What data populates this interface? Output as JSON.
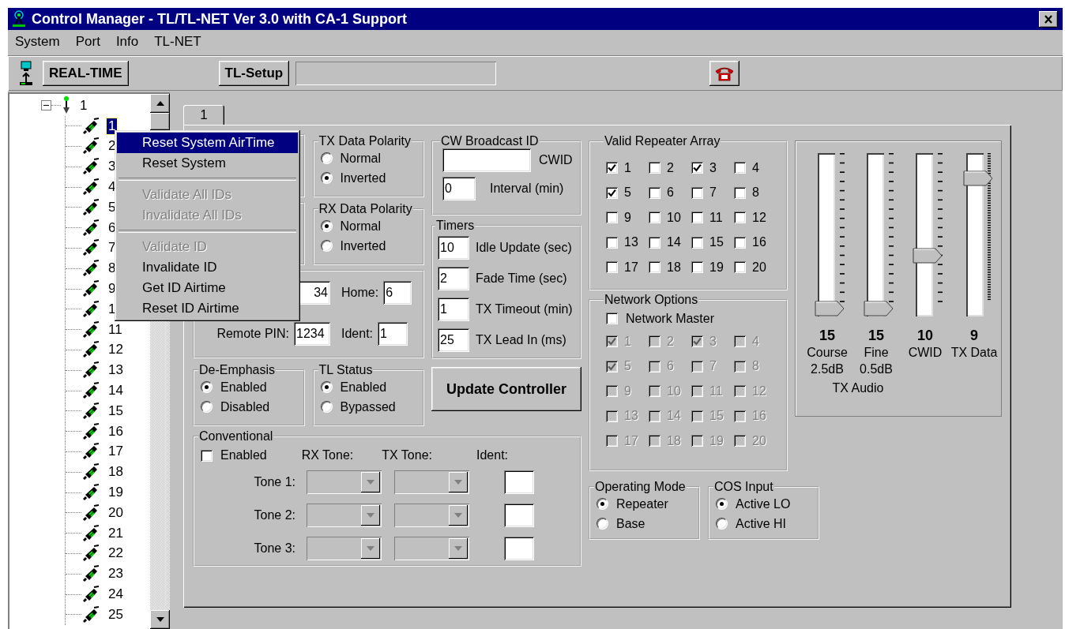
{
  "window": {
    "title": "Control Manager - TL/TL-NET Ver 3.0 with CA-1 Support"
  },
  "menu_bar": [
    {
      "label": "System"
    },
    {
      "label": "Port"
    },
    {
      "label": "Info"
    },
    {
      "label": "TL-NET"
    }
  ],
  "toolbar": {
    "realtime_button": "REAL-TIME",
    "setup_button": "TL-Setup"
  },
  "tree": {
    "label": "1",
    "expanded": true,
    "children": [
      {
        "label": "1",
        "selected": true
      },
      {
        "label": "2",
        "selected": false
      },
      {
        "label": "3",
        "selected": false
      },
      {
        "label": "4",
        "selected": false
      },
      {
        "label": "5",
        "selected": false
      },
      {
        "label": "6",
        "selected": false
      },
      {
        "label": "7",
        "selected": false
      },
      {
        "label": "8",
        "selected": false
      },
      {
        "label": "9",
        "selected": false
      },
      {
        "label": "1",
        "selected": false
      },
      {
        "label": "11",
        "selected": false
      },
      {
        "label": "12",
        "selected": false
      },
      {
        "label": "13",
        "selected": false
      },
      {
        "label": "14",
        "selected": false
      },
      {
        "label": "15",
        "selected": false
      },
      {
        "label": "16",
        "selected": false
      },
      {
        "label": "17",
        "selected": false
      },
      {
        "label": "18",
        "selected": false
      },
      {
        "label": "19",
        "selected": false
      },
      {
        "label": "20",
        "selected": false
      },
      {
        "label": "21",
        "selected": false
      },
      {
        "label": "22",
        "selected": false
      },
      {
        "label": "23",
        "selected": false
      },
      {
        "label": "24",
        "selected": false
      },
      {
        "label": "25",
        "selected": false
      }
    ]
  },
  "context_menu": [
    {
      "kind": "item",
      "label": "Reset System AirTime",
      "selected": true,
      "disabled": false
    },
    {
      "kind": "item",
      "label": "Reset System",
      "selected": false,
      "disabled": false
    },
    {
      "kind": "separator"
    },
    {
      "kind": "item",
      "label": "Validate All IDs",
      "selected": false,
      "disabled": true
    },
    {
      "kind": "item",
      "label": "Invalidate All IDs",
      "selected": false,
      "disabled": true
    },
    {
      "kind": "separator"
    },
    {
      "kind": "item",
      "label": "Validate ID",
      "selected": false,
      "disabled": true
    },
    {
      "kind": "item",
      "label": "Invalidate ID",
      "selected": false,
      "disabled": false
    },
    {
      "kind": "item",
      "label": "Get ID Airtime",
      "selected": false,
      "disabled": false
    },
    {
      "kind": "item",
      "label": "Reset ID Airtime",
      "selected": false,
      "disabled": false
    }
  ],
  "tabs": [
    {
      "label": "1",
      "selected": true
    }
  ],
  "tx_data_polarity": {
    "title": "TX Data Polarity",
    "options": [
      {
        "label": "Normal",
        "selected": false
      },
      {
        "label": "Inverted",
        "selected": true
      }
    ]
  },
  "rx_data_polarity": {
    "title": "RX Data Polarity",
    "options": [
      {
        "label": "Normal",
        "selected": true
      },
      {
        "label": "Inverted",
        "selected": false
      }
    ]
  },
  "id_fields": [
    {
      "value": "34"
    },
    {
      "label": "Home:",
      "value": "6"
    },
    {
      "label": "Remote PIN:",
      "value": "1234"
    },
    {
      "label": "Ident:",
      "value": "1"
    }
  ],
  "cw_broadcast_id": {
    "title": "CW Broadcast ID",
    "fields": [
      {
        "label": "CWID"
      },
      {
        "label": "Interval (min)",
        "value": "0"
      }
    ]
  },
  "timers": {
    "title": "Timers",
    "fields": [
      {
        "label": "Idle Update (sec)",
        "value": "10"
      },
      {
        "label": "Fade Time (sec)",
        "value": "2"
      },
      {
        "label": "TX Timeout (min)",
        "value": "1"
      },
      {
        "label": "TX Lead In (ms)",
        "value": "25"
      }
    ]
  },
  "update_button": "Update Controller",
  "de_emphasis": {
    "title": "De-Emphasis",
    "options": [
      {
        "label": "Enabled",
        "selected": true
      },
      {
        "label": "Disabled",
        "selected": false
      }
    ]
  },
  "tl_status": {
    "title": "TL Status",
    "options": [
      {
        "label": "Enabled",
        "selected": true
      },
      {
        "label": "Bypassed",
        "selected": false
      }
    ]
  },
  "conventional": {
    "title": "Conventional",
    "enabled": {
      "label": "Enabled",
      "checked": false
    },
    "headers": [
      "RX Tone:",
      "TX Tone:",
      "Ident:"
    ],
    "rows": [
      {
        "label": "Tone 1:",
        "disabled": true
      },
      {
        "label": "Tone 2:",
        "disabled": true
      },
      {
        "label": "Tone 3:",
        "disabled": true
      }
    ]
  },
  "valid_repeater_array": {
    "title": "Valid Repeater Array",
    "disabled": false,
    "items": [
      {
        "label": "1",
        "checked": true
      },
      {
        "label": "2",
        "checked": false
      },
      {
        "label": "3",
        "checked": true
      },
      {
        "label": "4",
        "checked": false
      },
      {
        "label": "5",
        "checked": true
      },
      {
        "label": "6",
        "checked": false
      },
      {
        "label": "7",
        "checked": false
      },
      {
        "label": "8",
        "checked": false
      },
      {
        "label": "9",
        "checked": false
      },
      {
        "label": "10",
        "checked": false
      },
      {
        "label": "11",
        "checked": false
      },
      {
        "label": "12",
        "checked": false
      },
      {
        "label": "13",
        "checked": false
      },
      {
        "label": "14",
        "checked": false
      },
      {
        "label": "15",
        "checked": false
      },
      {
        "label": "16",
        "checked": false
      },
      {
        "label": "17",
        "checked": false
      },
      {
        "label": "18",
        "checked": false
      },
      {
        "label": "19",
        "checked": false
      },
      {
        "label": "20",
        "checked": false
      }
    ]
  },
  "network_options": {
    "title": "Network Options",
    "master": {
      "label": "Network Master",
      "checked": false
    },
    "disabled": true,
    "items": [
      {
        "label": "1",
        "checked": true
      },
      {
        "label": "2",
        "checked": false
      },
      {
        "label": "3",
        "checked": true
      },
      {
        "label": "4",
        "checked": false
      },
      {
        "label": "5",
        "checked": true
      },
      {
        "label": "6",
        "checked": false
      },
      {
        "label": "7",
        "checked": false
      },
      {
        "label": "8",
        "checked": false
      },
      {
        "label": "9",
        "checked": false
      },
      {
        "label": "10",
        "checked": false
      },
      {
        "label": "11",
        "checked": false
      },
      {
        "label": "12",
        "checked": false
      },
      {
        "label": "13",
        "checked": false
      },
      {
        "label": "14",
        "checked": false
      },
      {
        "label": "15",
        "checked": false
      },
      {
        "label": "16",
        "checked": false
      },
      {
        "label": "17",
        "checked": false
      },
      {
        "label": "18",
        "checked": false
      },
      {
        "label": "19",
        "checked": false
      },
      {
        "label": "20",
        "checked": false
      }
    ]
  },
  "sliders": [
    {
      "value": "15",
      "label": "Course",
      "sublabel": "2.5dB",
      "level": 0,
      "kind": "coarse"
    },
    {
      "value": "15",
      "label": "Fine",
      "sublabel": "0.5dB",
      "level": 0,
      "kind": "coarse"
    },
    {
      "value": "10",
      "label": "CWID",
      "level": 0.36,
      "kind": "coarse"
    },
    {
      "value": "9",
      "label": "TX Data",
      "level": 0.88,
      "kind": "fine"
    }
  ],
  "slider_caption": "TX Audio",
  "operating_mode": {
    "title": "Operating Mode",
    "options": [
      {
        "label": "Repeater",
        "selected": true
      },
      {
        "label": "Base",
        "selected": false
      }
    ]
  },
  "cos_input": {
    "title": "COS Input",
    "options": [
      {
        "label": "Active LO",
        "selected": true
      },
      {
        "label": "Active HI",
        "selected": false
      }
    ]
  }
}
